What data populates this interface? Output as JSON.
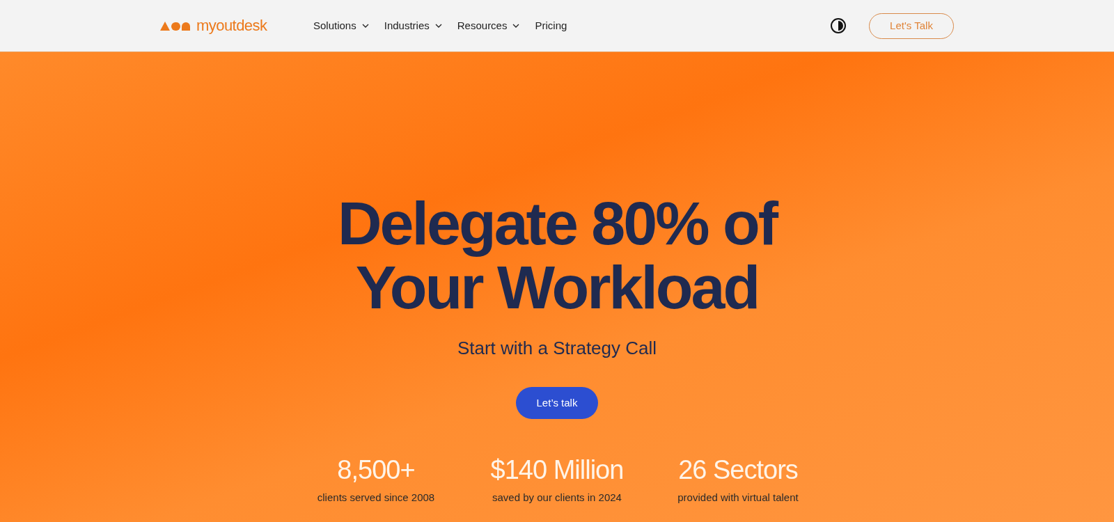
{
  "header": {
    "logo": "myoutdesk",
    "nav": [
      {
        "label": "Solutions",
        "dropdown": true
      },
      {
        "label": "Industries",
        "dropdown": true
      },
      {
        "label": "Resources",
        "dropdown": true
      },
      {
        "label": "Pricing",
        "dropdown": false
      }
    ],
    "cta": "Let's Talk"
  },
  "hero": {
    "heading_lines": [
      "Delegate 80% of",
      "Your Workload"
    ],
    "subtitle": "Start with a Strategy Call",
    "button": "Let’s talk",
    "stats": [
      {
        "value": "8,500+",
        "caption": "clients served since 2008"
      },
      {
        "value": "$140 Million",
        "caption": "saved by our clients in 2024"
      },
      {
        "value": "26 Sectors",
        "caption": "provided with virtual talent"
      }
    ]
  }
}
